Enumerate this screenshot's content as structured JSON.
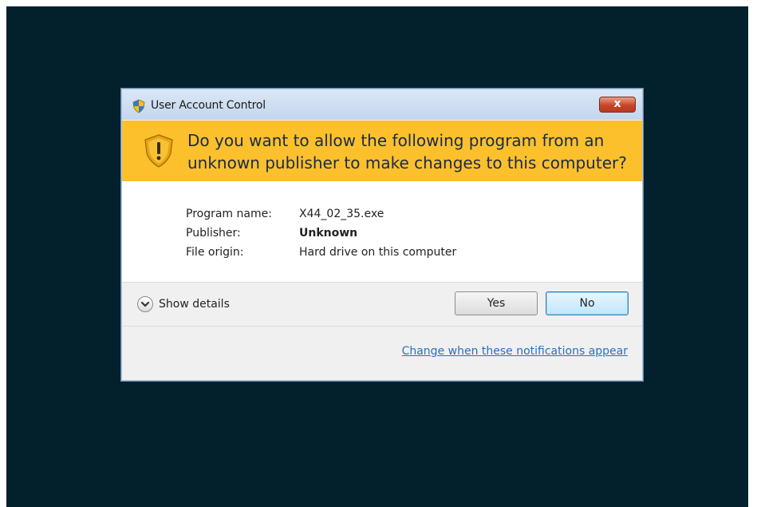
{
  "dialog": {
    "title": "User Account Control",
    "close_label": "x",
    "question": "Do you want to allow the following program from an unknown publisher to make changes to this computer?",
    "info": [
      {
        "label": "Program name:",
        "value": "X44_02_35.exe"
      },
      {
        "label": "Publisher:",
        "value": "Unknown"
      },
      {
        "label": "File origin:",
        "value": "Hard drive on this computer"
      }
    ],
    "show_details_label": "Show details",
    "yes_label": "Yes",
    "no_label": "No",
    "notifications_link": "Change when these notifications appear"
  },
  "colors": {
    "desktop": "#03202d",
    "banner": "#fcc02d",
    "link": "#2a6fc1"
  },
  "icons": {
    "title": "uac-shield-icon",
    "banner": "warning-shield-icon",
    "close": "close-icon",
    "details": "chevron-down-icon"
  }
}
